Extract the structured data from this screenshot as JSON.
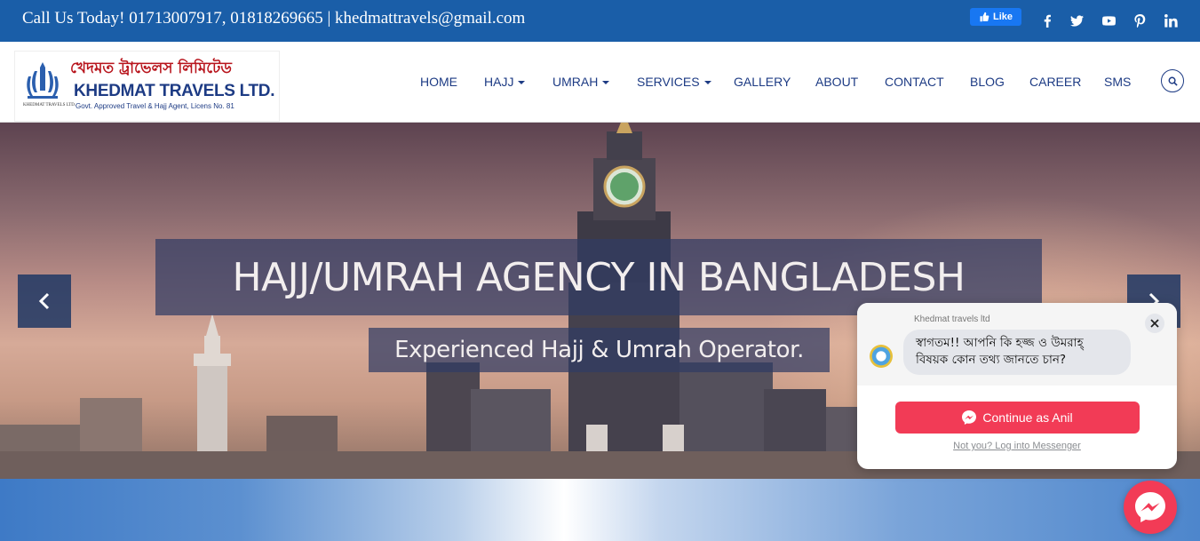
{
  "topbar": {
    "call_text": "Call Us Today! 01713007917, 01818269665 | khedmattravels@gmail.com",
    "fb_like_label": "Like",
    "social_icons": [
      "facebook-icon",
      "twitter-icon",
      "youtube-icon",
      "pinterest-icon",
      "linkedin-icon"
    ]
  },
  "logo": {
    "bangla_name": "খেদমত ট্রাভেলস লিমিটেড",
    "english_name": "KHEDMAT TRAVELS LTD.",
    "subtitle": "Govt. Approved Travel & Hajj Agent, Licens No. 81",
    "emblem_caption": "KHEDMAT TRAVELS LTD."
  },
  "nav": {
    "items": [
      {
        "label": "HOME",
        "dropdown": false
      },
      {
        "label": "HAJJ",
        "dropdown": true
      },
      {
        "label": "UMRAH",
        "dropdown": true
      },
      {
        "label": "SERVICES",
        "dropdown": true
      },
      {
        "label": "GALLERY",
        "dropdown": false
      },
      {
        "label": "ABOUT",
        "dropdown": false
      },
      {
        "label": "CONTACT",
        "dropdown": false
      },
      {
        "label": "BLOG",
        "dropdown": false
      },
      {
        "label": "CAREER",
        "dropdown": false
      },
      {
        "label": "SMS",
        "dropdown": false
      }
    ]
  },
  "hero": {
    "title": "HAJJ/UMRAH AGENCY IN BANGLADESH",
    "subtitle": "Experienced Hajj & Umrah Operator."
  },
  "chat": {
    "page_name": "Khedmat travels ltd",
    "message_line1": "স্বাগতম!! আপনি কি হজ্জ ও উমরাহ্",
    "message_line2": "বিষয়ক কোন তথ্য জানতে চান?",
    "continue_label": "Continue as Anil",
    "not_you_label": "Not you? Log into Messenger"
  },
  "colors": {
    "topbar": "#1a5ea8",
    "nav_text": "#1d3b84",
    "logo_red": "#b8141c",
    "messenger_red": "#f23b56",
    "hero_overlay": "#303c64"
  }
}
